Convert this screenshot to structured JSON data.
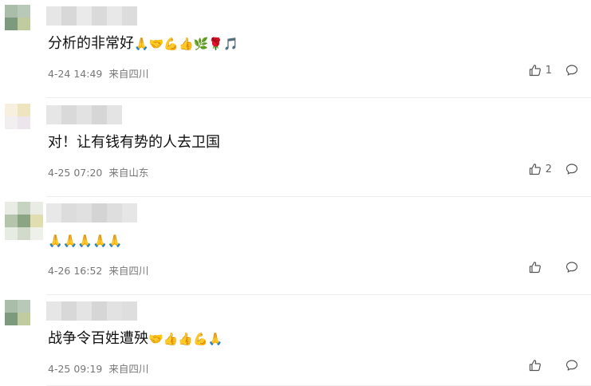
{
  "comments": [
    {
      "text": "分析的非常好",
      "emojis": "🙏🤝💪👍🌿🌹🎵",
      "date": "4-24 14:49",
      "location": "来自四川",
      "likes": "1",
      "avatar_colors": [
        "#a9bda9",
        "#b9c9b9",
        "#ffffff",
        "#7e9a7e",
        "#c0cca0",
        "#ffffff",
        "#ffffff",
        "#ffffff",
        "#ffffff"
      ]
    },
    {
      "text": "对！让有钱有势的人去卫国",
      "emojis": "",
      "date": "4-25 07:20",
      "location": "来自山东",
      "likes": "2",
      "avatar_colors": [
        "#f7f0e0",
        "#efe4c0",
        "#ffffff",
        "#f1efef",
        "#ece6ec",
        "#ffffff",
        "#ffffff",
        "#ffffff",
        "#ffffff"
      ]
    },
    {
      "text": "",
      "emojis": "🙏🙏🙏🙏🙏",
      "date": "4-26 16:52",
      "location": "来自四川",
      "likes": "",
      "avatar_colors": [
        "#e8ece4",
        "#c5d3c0",
        "#e8ece4",
        "#b5c5ad",
        "#8ba482",
        "#e0ddb0",
        "#e7ece3",
        "#d2dacb",
        "#eef0ea"
      ]
    },
    {
      "text": "战争令百姓遭殃",
      "emojis": "🤝👍👍💪🙏",
      "date": "4-25 09:19",
      "location": "来自四川",
      "likes": "",
      "avatar_colors": [
        "#a9bda9",
        "#b9c9b9",
        "#ffffff",
        "#7e9a7e",
        "#c0cca0",
        "#ffffff",
        "#ffffff",
        "#ffffff",
        "#ffffff"
      ]
    }
  ]
}
